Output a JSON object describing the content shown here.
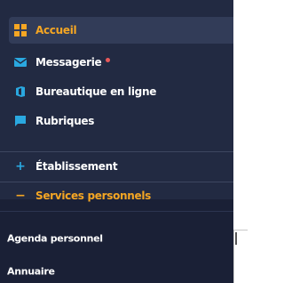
{
  "colors": {
    "sidebar_bg": "#222a42",
    "sidebar_bg_dark": "#1a2036",
    "active_bg": "#323c58",
    "accent_orange": "#f5a623",
    "icon_blue": "#2aa8e0",
    "notification_dot": "#e8595a"
  },
  "nav": {
    "items": [
      {
        "label": "Accueil",
        "icon": "grid-icon",
        "active": true
      },
      {
        "label": "Messagerie",
        "icon": "envelope-icon",
        "notification": true
      },
      {
        "label": "Bureautique en ligne",
        "icon": "office-icon"
      },
      {
        "label": "Rubriques",
        "icon": "chat-bubble-icon"
      }
    ]
  },
  "sections": {
    "etablissement": {
      "label": "Établissement",
      "toggle": "+"
    },
    "services": {
      "label": "Services personnels",
      "toggle": "−",
      "expanded": true,
      "items": [
        {
          "label": "Agenda personnel"
        },
        {
          "label": "Annuaire"
        }
      ]
    }
  }
}
